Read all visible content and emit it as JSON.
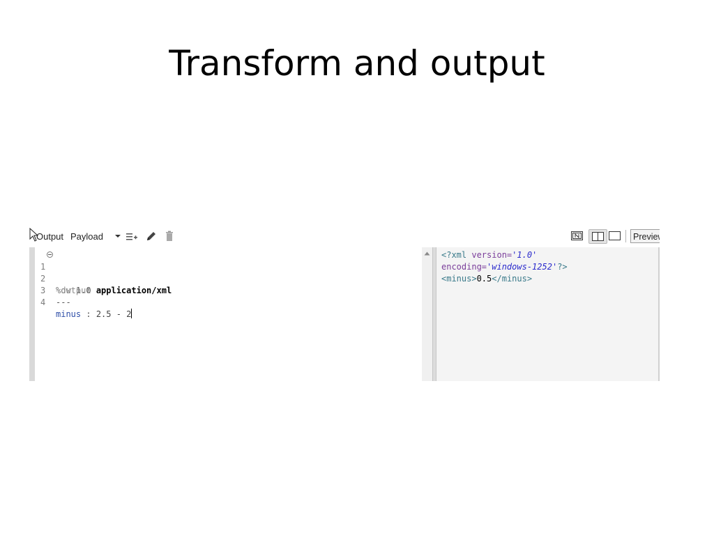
{
  "slide": {
    "title": "Transform and output"
  },
  "toolbar": {
    "output_label": "Output",
    "payload_label": "Payload",
    "preview_label": "Preview",
    "icons": [
      "cursor-icon",
      "caret-down-icon",
      "add-list-icon",
      "pencil-icon",
      "trash-icon",
      "source-only-icon",
      "split-view-icon",
      "single-view-icon"
    ]
  },
  "script": {
    "lines": [
      {
        "num": "1",
        "directive": "%dw",
        "value": " 1.0"
      },
      {
        "num": "2",
        "directive": "%output",
        "value": "application/xml"
      },
      {
        "num": "3",
        "text": "---"
      },
      {
        "num": "4",
        "key": "minus",
        "sep": " : ",
        "expr": "2.5 - 2"
      }
    ]
  },
  "output": {
    "line1_open": "<?xml ",
    "line1_attr": "version=",
    "line1_val": "'1.0'",
    "line2_attr": "encoding=",
    "line2_val": "'windows-1252'",
    "line2_close": "?>",
    "line3_open": "<minus>",
    "line3_value": "0.5",
    "line3_close": "</minus>"
  },
  "colors": {
    "accent_key": "#2f4fa8",
    "xml_string": "#2a2acc",
    "xml_tag": "#3a7a8a"
  }
}
